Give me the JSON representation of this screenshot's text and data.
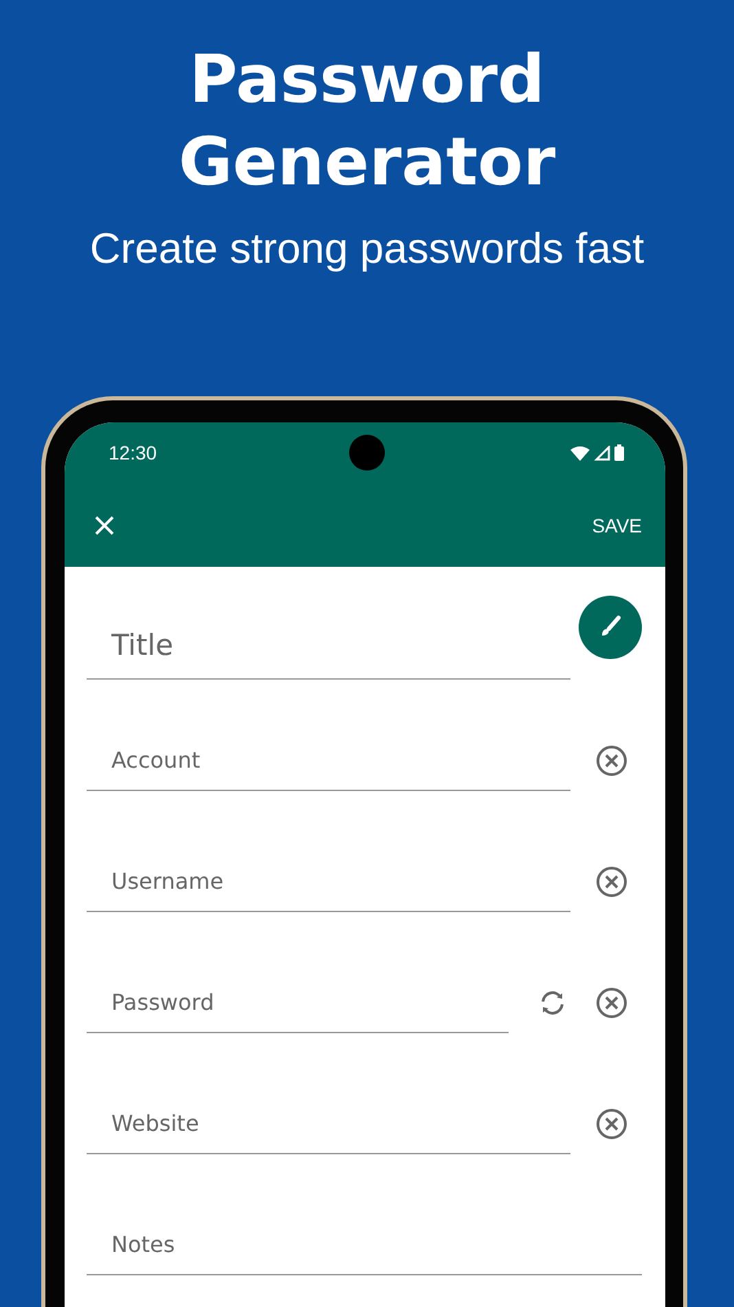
{
  "headline": "Password Generator",
  "subheadline": "Create strong passwords fast",
  "status_bar": {
    "time": "12:30"
  },
  "app_bar": {
    "action": "SAVE"
  },
  "fields": [
    {
      "kind": "title",
      "placeholder": "Title"
    },
    {
      "kind": "clearable",
      "placeholder": "Account"
    },
    {
      "kind": "clearable",
      "placeholder": "Username"
    },
    {
      "kind": "password",
      "placeholder": "Password"
    },
    {
      "kind": "clearable",
      "placeholder": "Website"
    },
    {
      "kind": "plain",
      "placeholder": "Notes"
    }
  ]
}
